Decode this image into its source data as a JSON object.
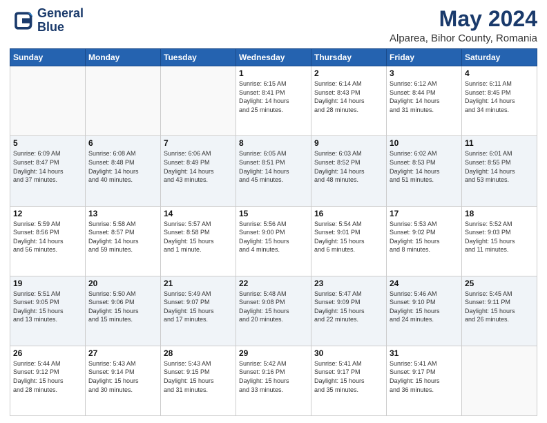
{
  "logo": {
    "line1": "General",
    "line2": "Blue"
  },
  "title": "May 2024",
  "subtitle": "Alparea, Bihor County, Romania",
  "days_of_week": [
    "Sunday",
    "Monday",
    "Tuesday",
    "Wednesday",
    "Thursday",
    "Friday",
    "Saturday"
  ],
  "weeks": [
    [
      {
        "day": "",
        "info": ""
      },
      {
        "day": "",
        "info": ""
      },
      {
        "day": "",
        "info": ""
      },
      {
        "day": "1",
        "info": "Sunrise: 6:15 AM\nSunset: 8:41 PM\nDaylight: 14 hours\nand 25 minutes."
      },
      {
        "day": "2",
        "info": "Sunrise: 6:14 AM\nSunset: 8:43 PM\nDaylight: 14 hours\nand 28 minutes."
      },
      {
        "day": "3",
        "info": "Sunrise: 6:12 AM\nSunset: 8:44 PM\nDaylight: 14 hours\nand 31 minutes."
      },
      {
        "day": "4",
        "info": "Sunrise: 6:11 AM\nSunset: 8:45 PM\nDaylight: 14 hours\nand 34 minutes."
      }
    ],
    [
      {
        "day": "5",
        "info": "Sunrise: 6:09 AM\nSunset: 8:47 PM\nDaylight: 14 hours\nand 37 minutes."
      },
      {
        "day": "6",
        "info": "Sunrise: 6:08 AM\nSunset: 8:48 PM\nDaylight: 14 hours\nand 40 minutes."
      },
      {
        "day": "7",
        "info": "Sunrise: 6:06 AM\nSunset: 8:49 PM\nDaylight: 14 hours\nand 43 minutes."
      },
      {
        "day": "8",
        "info": "Sunrise: 6:05 AM\nSunset: 8:51 PM\nDaylight: 14 hours\nand 45 minutes."
      },
      {
        "day": "9",
        "info": "Sunrise: 6:03 AM\nSunset: 8:52 PM\nDaylight: 14 hours\nand 48 minutes."
      },
      {
        "day": "10",
        "info": "Sunrise: 6:02 AM\nSunset: 8:53 PM\nDaylight: 14 hours\nand 51 minutes."
      },
      {
        "day": "11",
        "info": "Sunrise: 6:01 AM\nSunset: 8:55 PM\nDaylight: 14 hours\nand 53 minutes."
      }
    ],
    [
      {
        "day": "12",
        "info": "Sunrise: 5:59 AM\nSunset: 8:56 PM\nDaylight: 14 hours\nand 56 minutes."
      },
      {
        "day": "13",
        "info": "Sunrise: 5:58 AM\nSunset: 8:57 PM\nDaylight: 14 hours\nand 59 minutes."
      },
      {
        "day": "14",
        "info": "Sunrise: 5:57 AM\nSunset: 8:58 PM\nDaylight: 15 hours\nand 1 minute."
      },
      {
        "day": "15",
        "info": "Sunrise: 5:56 AM\nSunset: 9:00 PM\nDaylight: 15 hours\nand 4 minutes."
      },
      {
        "day": "16",
        "info": "Sunrise: 5:54 AM\nSunset: 9:01 PM\nDaylight: 15 hours\nand 6 minutes."
      },
      {
        "day": "17",
        "info": "Sunrise: 5:53 AM\nSunset: 9:02 PM\nDaylight: 15 hours\nand 8 minutes."
      },
      {
        "day": "18",
        "info": "Sunrise: 5:52 AM\nSunset: 9:03 PM\nDaylight: 15 hours\nand 11 minutes."
      }
    ],
    [
      {
        "day": "19",
        "info": "Sunrise: 5:51 AM\nSunset: 9:05 PM\nDaylight: 15 hours\nand 13 minutes."
      },
      {
        "day": "20",
        "info": "Sunrise: 5:50 AM\nSunset: 9:06 PM\nDaylight: 15 hours\nand 15 minutes."
      },
      {
        "day": "21",
        "info": "Sunrise: 5:49 AM\nSunset: 9:07 PM\nDaylight: 15 hours\nand 17 minutes."
      },
      {
        "day": "22",
        "info": "Sunrise: 5:48 AM\nSunset: 9:08 PM\nDaylight: 15 hours\nand 20 minutes."
      },
      {
        "day": "23",
        "info": "Sunrise: 5:47 AM\nSunset: 9:09 PM\nDaylight: 15 hours\nand 22 minutes."
      },
      {
        "day": "24",
        "info": "Sunrise: 5:46 AM\nSunset: 9:10 PM\nDaylight: 15 hours\nand 24 minutes."
      },
      {
        "day": "25",
        "info": "Sunrise: 5:45 AM\nSunset: 9:11 PM\nDaylight: 15 hours\nand 26 minutes."
      }
    ],
    [
      {
        "day": "26",
        "info": "Sunrise: 5:44 AM\nSunset: 9:12 PM\nDaylight: 15 hours\nand 28 minutes."
      },
      {
        "day": "27",
        "info": "Sunrise: 5:43 AM\nSunset: 9:14 PM\nDaylight: 15 hours\nand 30 minutes."
      },
      {
        "day": "28",
        "info": "Sunrise: 5:43 AM\nSunset: 9:15 PM\nDaylight: 15 hours\nand 31 minutes."
      },
      {
        "day": "29",
        "info": "Sunrise: 5:42 AM\nSunset: 9:16 PM\nDaylight: 15 hours\nand 33 minutes."
      },
      {
        "day": "30",
        "info": "Sunrise: 5:41 AM\nSunset: 9:17 PM\nDaylight: 15 hours\nand 35 minutes."
      },
      {
        "day": "31",
        "info": "Sunrise: 5:41 AM\nSunset: 9:17 PM\nDaylight: 15 hours\nand 36 minutes."
      },
      {
        "day": "",
        "info": ""
      }
    ]
  ]
}
